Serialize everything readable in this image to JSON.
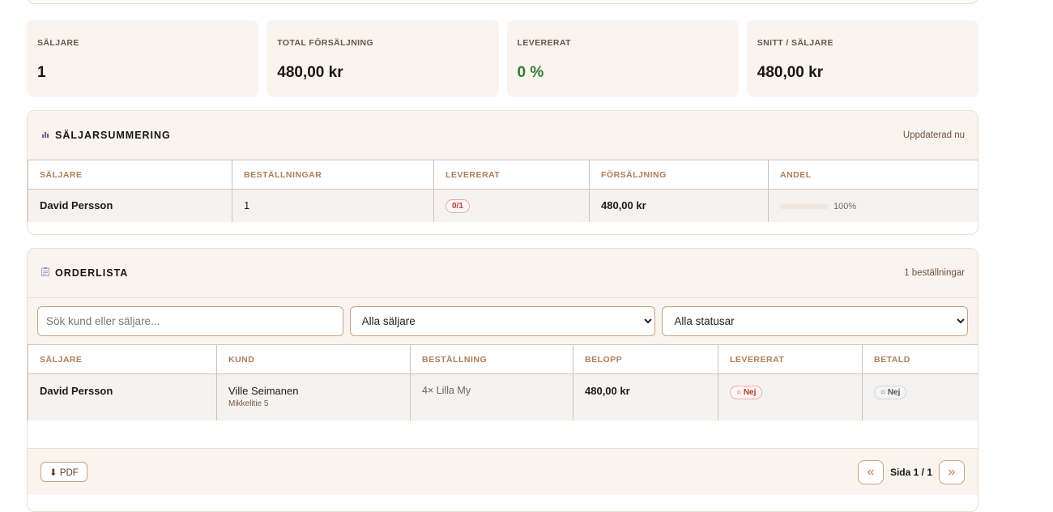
{
  "stats": [
    {
      "label": "SÄLJARE",
      "value": "1"
    },
    {
      "label": "TOTAL FÖRSÄLJNING",
      "value": "480,00 kr"
    },
    {
      "label": "LEVERERAT",
      "value": "0 %"
    },
    {
      "label": "SNITT / SÄLJARE",
      "value": "480,00 kr"
    }
  ],
  "summary": {
    "title": "SÄLJARSUMMERING",
    "icon": "bar-chart-icon",
    "meta": "Uppdaterad nu",
    "columns": [
      "SÄLJARE",
      "BESTÄLLNINGAR",
      "LEVERERAT",
      "FÖRSÄLJNING",
      "ANDEL"
    ],
    "row": {
      "seller": "David Persson",
      "orders": "1",
      "delivered": "0/1",
      "sales": "480,00 kr",
      "share_pct": "100%",
      "share_fraction": 1.0
    }
  },
  "orders": {
    "title": "ORDERLISTA",
    "icon": "clipboard-icon",
    "meta": "1 beställningar",
    "search_placeholder": "Sök kund eller säljare...",
    "seller_filter": "Alla säljare",
    "status_filter": "Alla statusar",
    "columns": [
      "SÄLJARE",
      "KUND",
      "BESTÄLLNING",
      "BELOPP",
      "LEVERERAT",
      "BETALD"
    ],
    "row": {
      "seller": "David Persson",
      "customer": "Ville Seimanen",
      "address": "Mikkelitie 5",
      "order": "4× Lilla My",
      "amount": "480,00 kr",
      "delivered": "○ Nej",
      "paid": "○ Nej"
    },
    "pdf_label": "⬇ PDF",
    "prev": "«",
    "page": "Sida 1 / 1",
    "next": "»"
  },
  "colors": {
    "accent": "#b07d57",
    "card_bg": "#faf4ef",
    "green": "#2e7d32",
    "red": "#b23a3a"
  }
}
